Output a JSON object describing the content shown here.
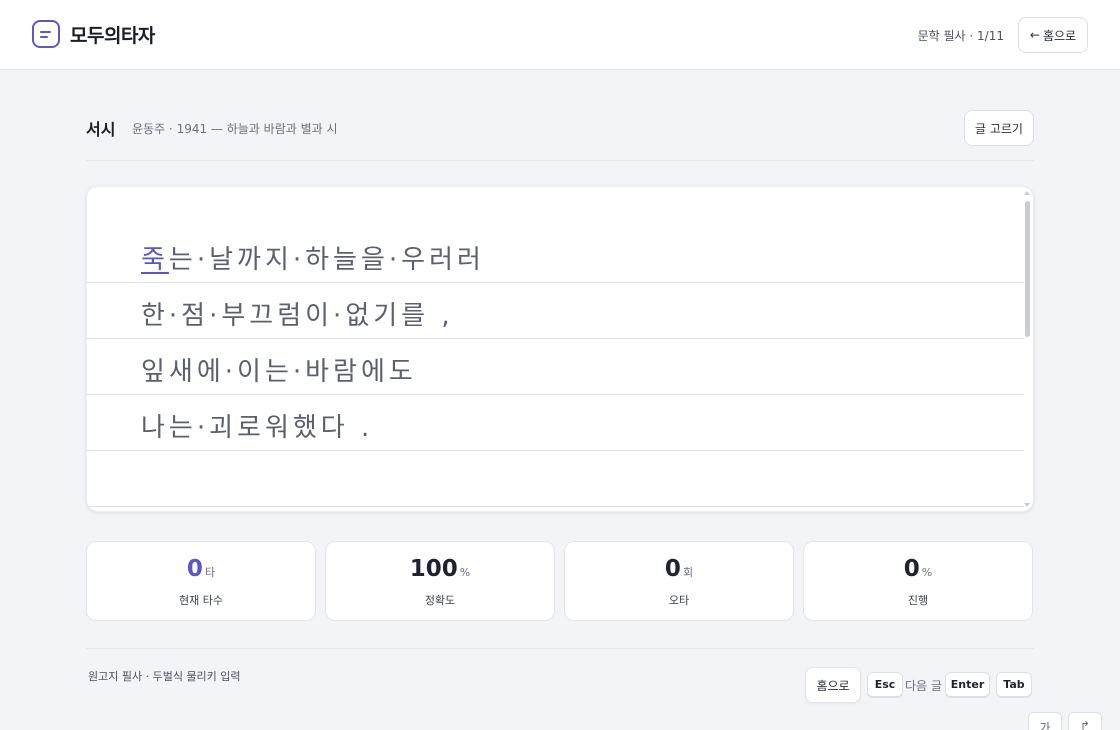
{
  "header": {
    "brand": "모두의타자",
    "progress": "문학 필사 · 1/11",
    "home_arrow": "←",
    "home_label": "홈으로"
  },
  "poem": {
    "title": "서시",
    "meta": "윤동주 · 1941 — 하늘과 바람과 별과 시",
    "pick_label": "글 고르기",
    "cursor_char": "죽",
    "lines": [
      "는·날까지·하늘을·우러러",
      "한·점·부끄럼이·없기를 ,",
      "잎새에·이는·바람에도",
      "나는·괴로워했다 ."
    ]
  },
  "stats": [
    {
      "value": "0",
      "unit": "타",
      "label": "현재 타수",
      "accent": true
    },
    {
      "value": "100",
      "unit": "%",
      "label": "정확도",
      "accent": false
    },
    {
      "value": "0",
      "unit": "회",
      "label": "오타",
      "accent": false
    },
    {
      "value": "0",
      "unit": "%",
      "label": "진행",
      "accent": false
    }
  ],
  "footer": {
    "note": "원고지 필사 · 두벌식 물리키 입력",
    "home_label": "홈으로",
    "esc": "Esc",
    "next_label": "다음 글",
    "enter": "Enter",
    "tab": "Tab"
  },
  "mini": {
    "font_btn": "가",
    "other_btn": "↱"
  },
  "colors": {
    "accent": "#5a57c7",
    "background": "#f3f4f7"
  }
}
